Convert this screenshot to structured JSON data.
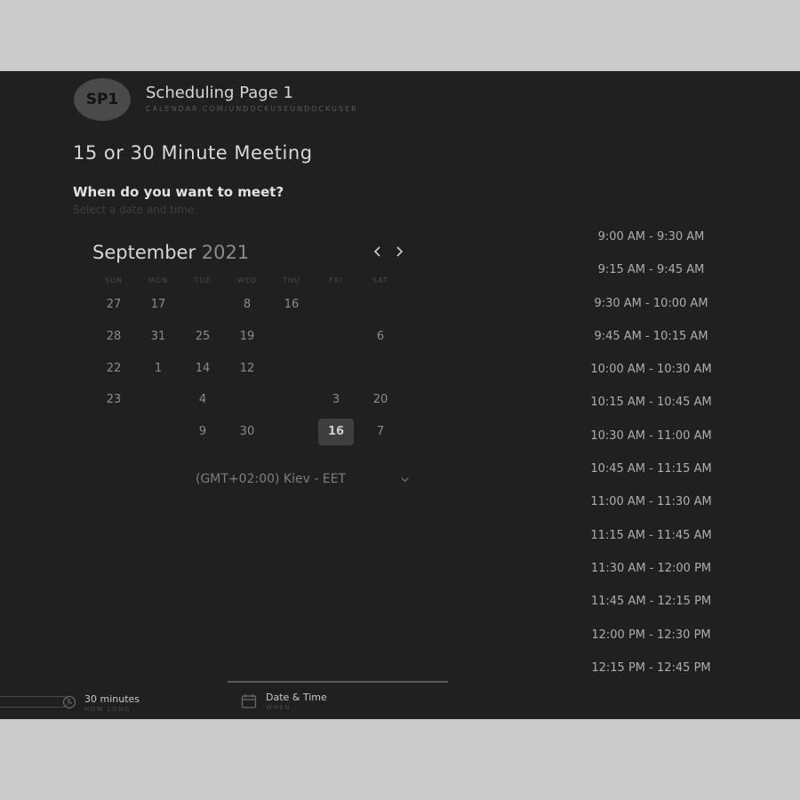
{
  "header": {
    "avatar_initials": "SP1",
    "title": "Scheduling Page 1",
    "subtitle": "CALENDAR.COM/UNDOCKUSEUNDOCKUSER"
  },
  "meeting": {
    "title": "15 or 30 Minute Meeting",
    "question": "When do you want to meet?",
    "hint": "Select a date and time"
  },
  "calendar": {
    "month": "September",
    "year": "2021",
    "prev_icon": "chevron-left-icon",
    "next_icon": "chevron-right-icon",
    "weekdays": [
      "SUN",
      "MON",
      "TUE",
      "WED",
      "THU",
      "FRI",
      "SAT"
    ],
    "rows": [
      [
        "27",
        "17",
        "",
        "8",
        "16",
        "",
        ""
      ],
      [
        "28",
        "31",
        "25",
        "19",
        "",
        "",
        "6"
      ],
      [
        "22",
        "1",
        "14",
        "12",
        "",
        "",
        ""
      ],
      [
        "23",
        "",
        "4",
        "",
        "",
        "3",
        "20"
      ],
      [
        "",
        "",
        "9",
        "30",
        "",
        "16",
        "7"
      ]
    ],
    "selected": "16"
  },
  "timezone": {
    "label": "(GMT+02:00) Kiev - EET",
    "icon": "chevron-down-icon"
  },
  "time_slots": [
    "9:00 AM - 9:30 AM",
    "9:15 AM - 9:45 AM",
    "9:30 AM - 10:00 AM",
    "9:45 AM - 10:15 AM",
    "10:00 AM - 10:30 AM",
    "10:15 AM - 10:45 AM",
    "10:30 AM - 11:00 AM",
    "10:45 AM - 11:15 AM",
    "11:00 AM - 11:30 AM",
    "11:15 AM - 11:45 AM",
    "11:30 AM - 12:00 PM",
    "11:45 AM - 12:15 PM",
    "12:00 PM - 12:30 PM",
    "12:15 PM - 12:45 PM"
  ],
  "footer": {
    "duration_label": "30 minutes",
    "duration_sub": "HOW LONG",
    "duration_icon": "clock-icon",
    "datetime_label": "Date & Time",
    "datetime_sub": "WHEN",
    "datetime_icon": "calendar-icon"
  }
}
